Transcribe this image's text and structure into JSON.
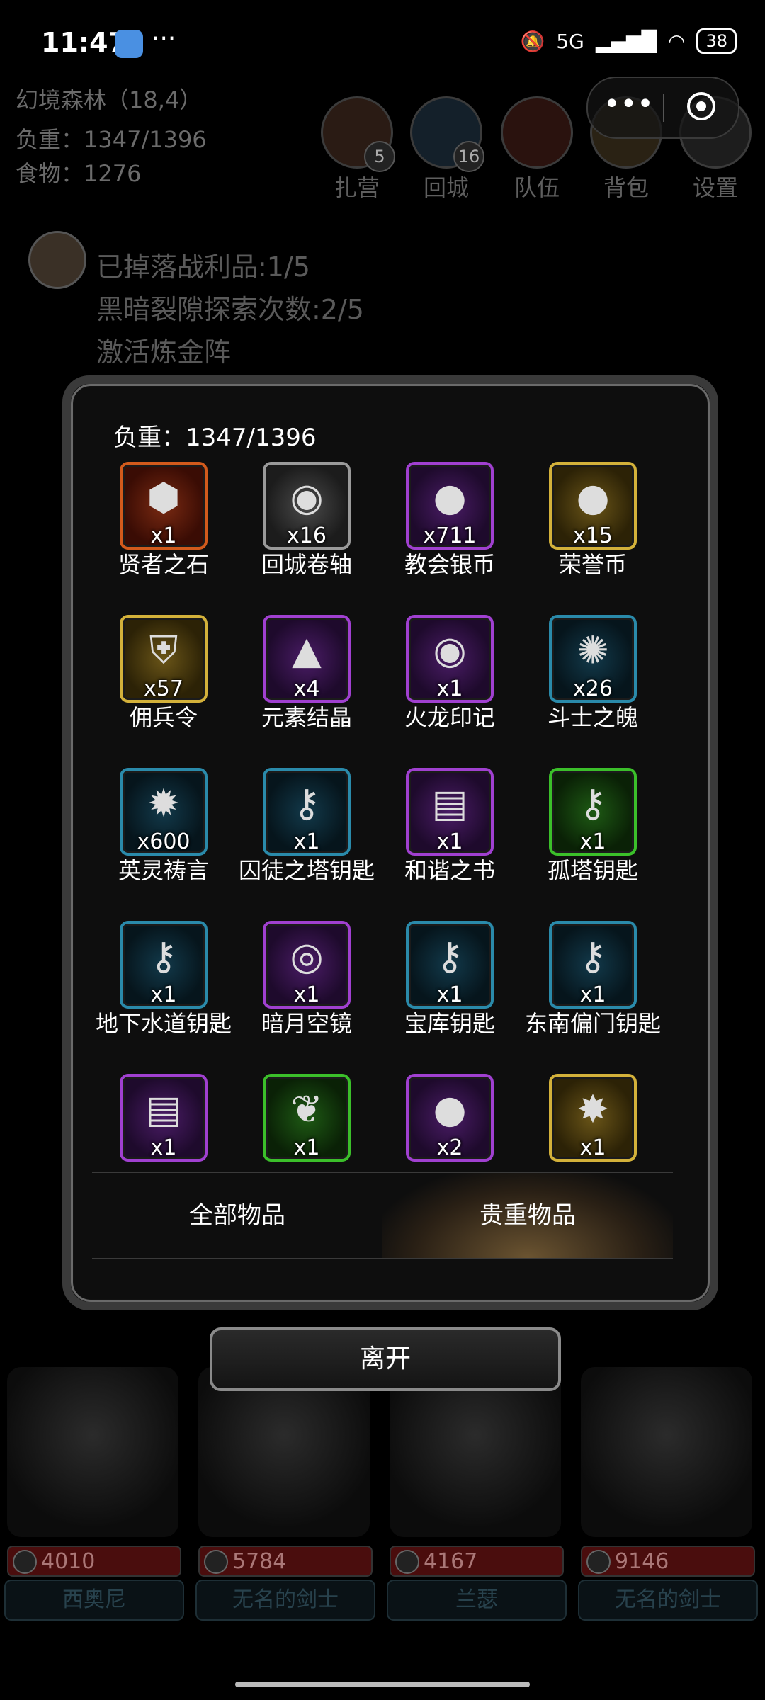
{
  "status_bar": {
    "time": "11:47",
    "more": "···",
    "network": "5G",
    "battery": "38"
  },
  "hud": {
    "location": "幻境森林（18,4）",
    "weight": "负重：1347/1396",
    "food": "食物：1276",
    "buttons": [
      {
        "label": "扎营",
        "count": "5"
      },
      {
        "label": "回城",
        "count": "16"
      },
      {
        "label": "队伍",
        "count": ""
      },
      {
        "label": "背包",
        "count": ""
      },
      {
        "label": "设置",
        "count": ""
      }
    ]
  },
  "background_log": [
    "已掉落战利品:1/5",
    "黑暗裂隙探索次数:2/5",
    "激活炼金阵"
  ],
  "modal": {
    "weight": "负重：1347/1396",
    "items": [
      {
        "name": "贤者之石",
        "qty": "x1",
        "rarity": "red",
        "icon": "stone-icon"
      },
      {
        "name": "回城卷轴",
        "qty": "x16",
        "rarity": "gray",
        "icon": "swirl-icon"
      },
      {
        "name": "教会银币",
        "qty": "x711",
        "rarity": "purple",
        "icon": "coin-icon"
      },
      {
        "name": "荣誉币",
        "qty": "x15",
        "rarity": "gold",
        "icon": "coin-icon"
      },
      {
        "name": "佣兵令",
        "qty": "x57",
        "rarity": "gold",
        "icon": "shield-icon"
      },
      {
        "name": "元素结晶",
        "qty": "x4",
        "rarity": "purple",
        "icon": "crystal-icon"
      },
      {
        "name": "火龙印记",
        "qty": "x1",
        "rarity": "purple",
        "icon": "swirl-icon"
      },
      {
        "name": "斗士之魄",
        "qty": "x26",
        "rarity": "blue",
        "icon": "soul-icon"
      },
      {
        "name": "英灵祷言",
        "qty": "x600",
        "rarity": "blue",
        "icon": "orb-icon"
      },
      {
        "name": "囚徒之塔钥匙",
        "qty": "x1",
        "rarity": "blue",
        "icon": "key-icon"
      },
      {
        "name": "和谐之书",
        "qty": "x1",
        "rarity": "purple",
        "icon": "book-icon"
      },
      {
        "name": "孤塔钥匙",
        "qty": "x1",
        "rarity": "green",
        "icon": "key-icon"
      },
      {
        "name": "地下水道钥匙",
        "qty": "x1",
        "rarity": "blue",
        "icon": "key-icon"
      },
      {
        "name": "暗月空镜",
        "qty": "x1",
        "rarity": "purple",
        "icon": "mirror-icon"
      },
      {
        "name": "宝库钥匙",
        "qty": "x1",
        "rarity": "blue",
        "icon": "key-icon"
      },
      {
        "name": "东南偏门钥匙",
        "qty": "x1",
        "rarity": "blue",
        "icon": "key-icon"
      },
      {
        "name": "",
        "qty": "x1",
        "rarity": "purple",
        "icon": "book-icon"
      },
      {
        "name": "",
        "qty": "x1",
        "rarity": "green",
        "icon": "herb-icon"
      },
      {
        "name": "",
        "qty": "x2",
        "rarity": "purple",
        "icon": "coin-icon"
      },
      {
        "name": "",
        "qty": "x1",
        "rarity": "gold",
        "icon": "fire-icon"
      }
    ],
    "tabs": {
      "all": "全部物品",
      "valuable": "贵重物品"
    }
  },
  "leave_button": "离开",
  "heroes": [
    {
      "hp": "4010",
      "name": "西奥尼"
    },
    {
      "hp": "5784",
      "name": "无名的剑士"
    },
    {
      "hp": "4167",
      "name": "兰瑟"
    },
    {
      "hp": "9146",
      "name": "无名的剑士"
    }
  ]
}
